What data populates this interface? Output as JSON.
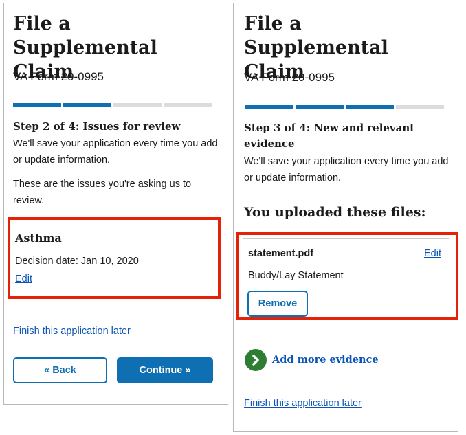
{
  "left": {
    "title": "File a Supplemental Claim",
    "form_number": "VA Form 20-0995",
    "step_heading": "Step 2 of 4: Issues for review",
    "save_note": "We'll save your application every time you add or update information.",
    "intro": "These are the issues you're asking us to review.",
    "issue": {
      "name": "Asthma",
      "decision_date": "Decision date: Jan 10, 2020",
      "edit_label": "Edit"
    },
    "finish_later": "Finish this application later",
    "back_label": "« Back",
    "continue_label": "Continue »"
  },
  "right": {
    "title": "File a Supplemental Claim",
    "form_number": "VA Form 20-0995",
    "step_heading": "Step 3 of 4: New and relevant evidence",
    "save_note": "We'll save your application every time you add or update information.",
    "uploads_heading": "You uploaded these files:",
    "file": {
      "name": "statement.pdf",
      "edit_label": "Edit",
      "type": "Buddy/Lay Statement",
      "remove_label": "Remove"
    },
    "add_more_label": "Add more evidence",
    "finish_later": "Finish this application later"
  },
  "colors": {
    "primary": "#0f6fb3",
    "link": "#0b55b7",
    "highlight": "#e52207",
    "add_icon": "#2e7d32",
    "progress_incomplete": "#dcdcdc"
  },
  "progress": {
    "left_completed": 2,
    "right_completed": 3,
    "total": 4
  },
  "icons": {
    "add_more": "chevron-right-circle-icon"
  }
}
